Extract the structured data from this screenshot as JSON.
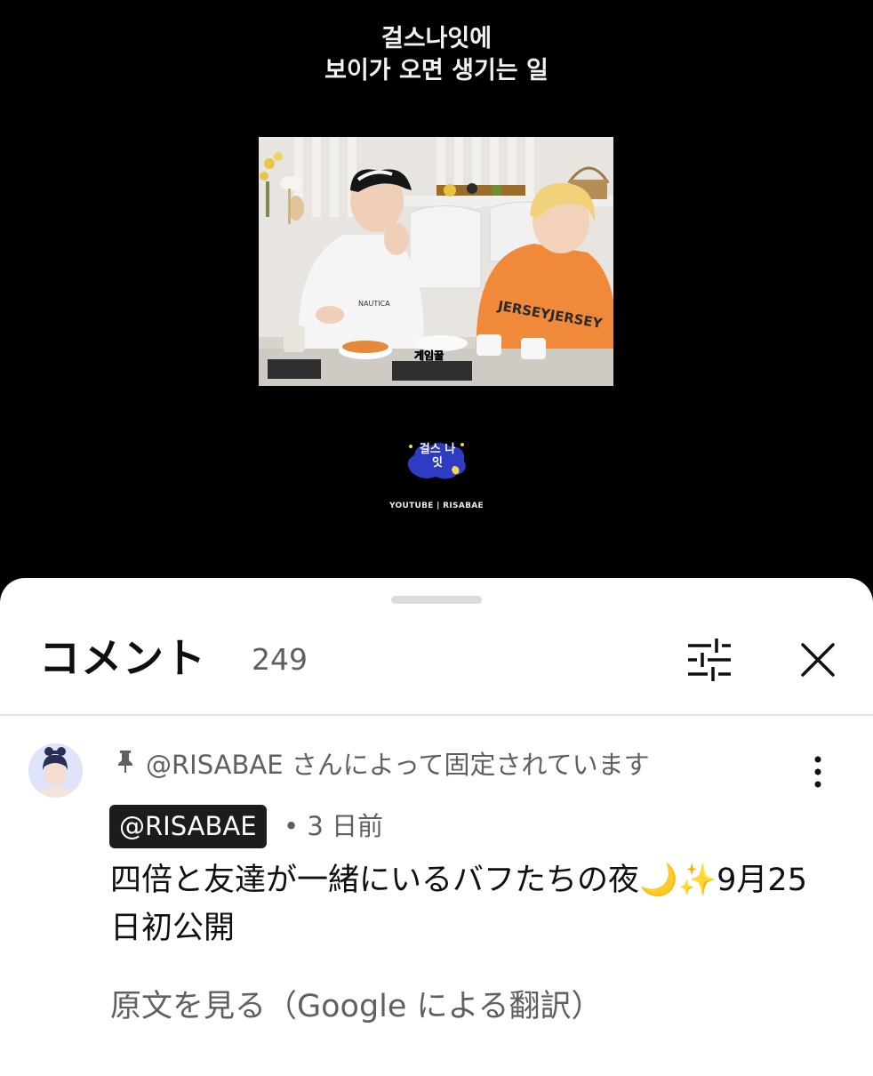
{
  "video": {
    "title_line1": "걸스나잇에",
    "title_line2": "보이가 오면 생기는 일",
    "subtitle_in_frame": "게임꿀",
    "shirt_text": "NAUTICA",
    "hoodie_text": "JERSEYJERSEY",
    "logo_text": "걸스 나잇",
    "credit": "YOUTUBE | RISABAE"
  },
  "sheet": {
    "title": "コメント",
    "count": "249",
    "sort_icon": "sliders-icon",
    "close_icon": "close-icon"
  },
  "comment": {
    "pinned_label": "@RISABAE さんによって固定されています",
    "author": "@RISABAE",
    "meta": "• 3 日前",
    "text": "四倍と友達が一緒にいるバフたちの夜🌙✨9月25日初公開",
    "see_original": "原文を見る（Google による翻訳）",
    "more_icon": "more-vertical-icon",
    "pin_icon": "pin-icon"
  }
}
